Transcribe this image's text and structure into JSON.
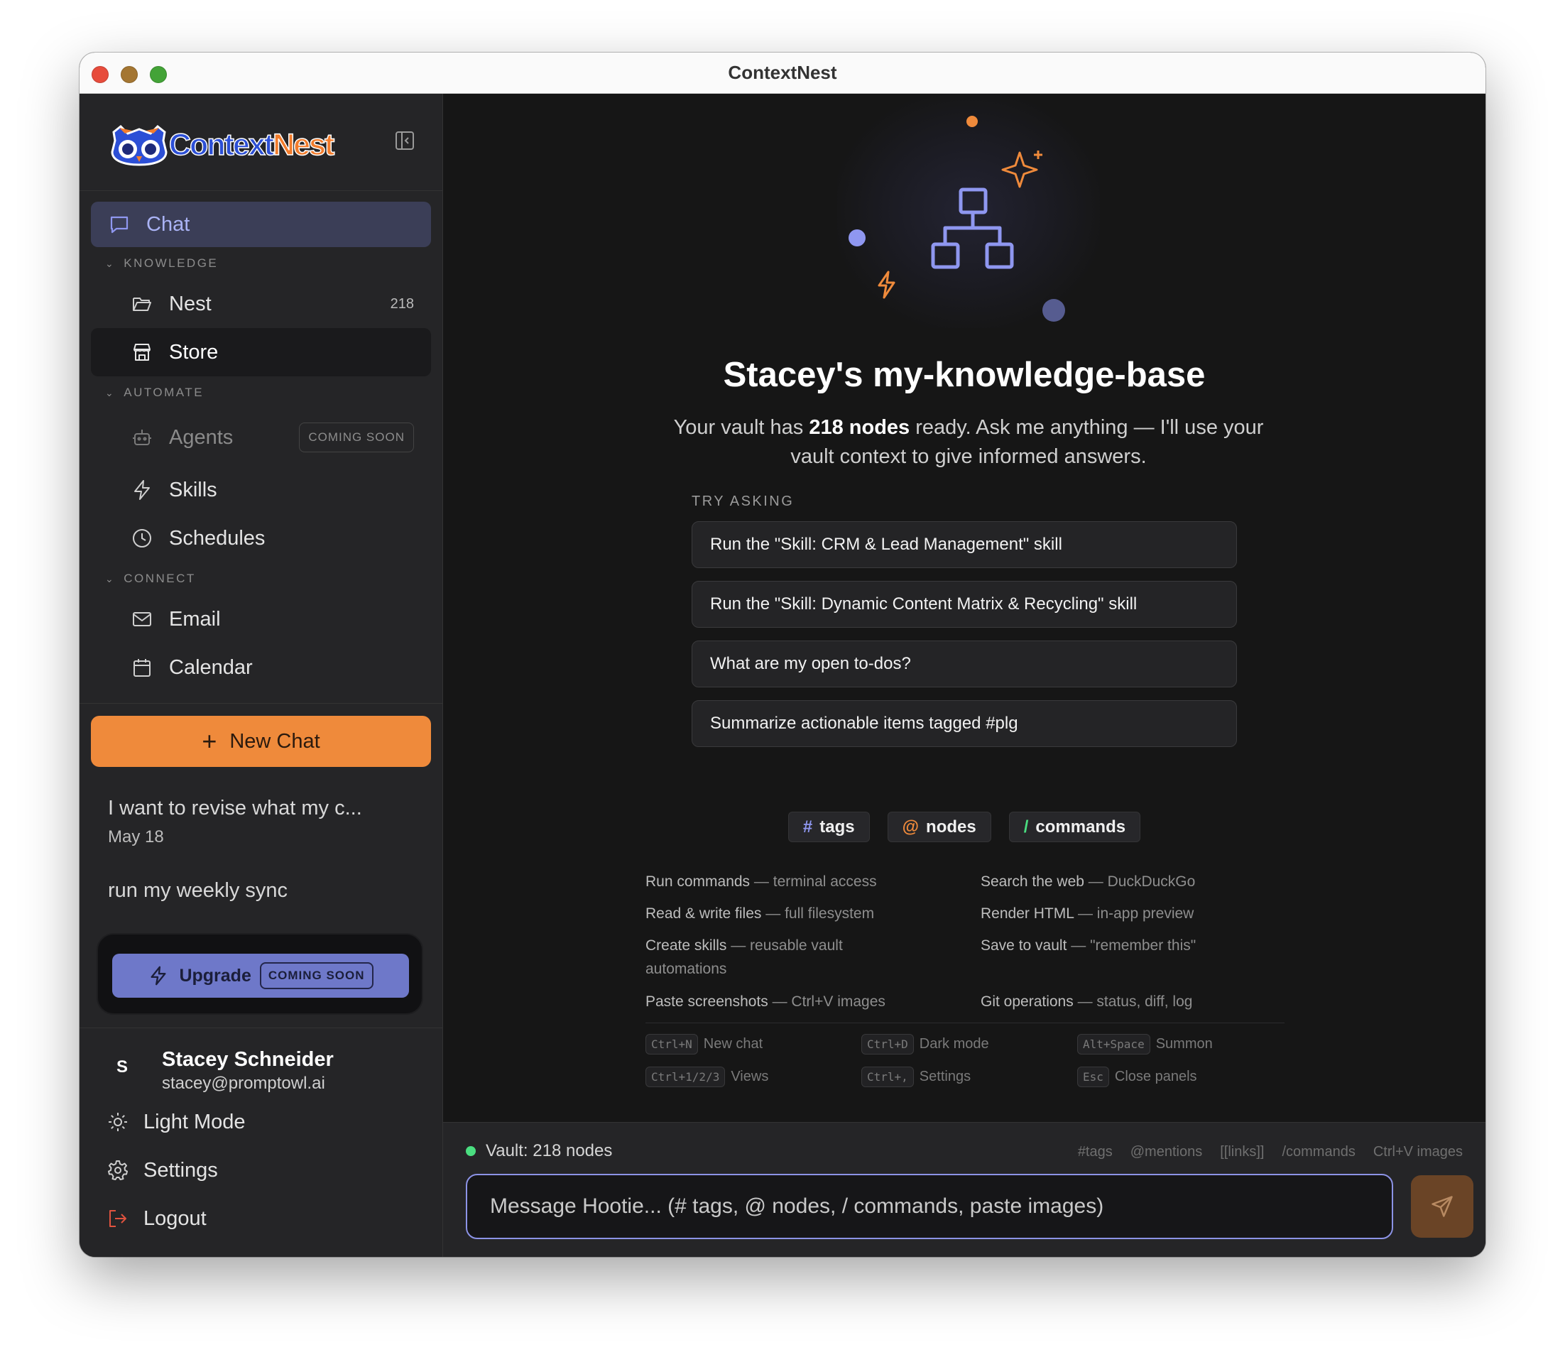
{
  "window": {
    "title": "ContextNest"
  },
  "sidebar": {
    "logo": {
      "part1": "Context",
      "part2": "Nest"
    },
    "chat_label": "Chat",
    "sections": {
      "knowledge": "KNOWLEDGE",
      "automate": "AUTOMATE",
      "connect": "CONNECT"
    },
    "nest": {
      "label": "Nest",
      "count": "218"
    },
    "store": {
      "label": "Store"
    },
    "agents": {
      "label": "Agents",
      "badge": "COMING SOON"
    },
    "skills": {
      "label": "Skills"
    },
    "schedules": {
      "label": "Schedules"
    },
    "email": {
      "label": "Email"
    },
    "calendar": {
      "label": "Calendar"
    },
    "new_chat": {
      "icon": "+",
      "label": "New Chat"
    },
    "history": [
      {
        "title": "I want to revise what my c...",
        "date": "May 18"
      },
      {
        "title": "run my weekly sync"
      }
    ],
    "upgrade": {
      "label": "Upgrade",
      "badge": "COMING SOON"
    },
    "user": {
      "initial": "S",
      "name": "Stacey Schneider",
      "email": "stacey@promptowl.ai"
    },
    "light_mode": "Light Mode",
    "settings": "Settings",
    "logout": "Logout"
  },
  "main": {
    "heading": "Stacey's my-knowledge-base",
    "subtitle": {
      "pre": "Your vault has ",
      "bold": "218 nodes",
      "post": " ready. Ask me anything — I'll use your vault context to give informed answers."
    },
    "try_label": "TRY ASKING",
    "suggestions": [
      "Run the \"Skill: CRM & Lead Management\" skill",
      "Run the \"Skill: Dynamic Content Matrix & Recycling\" skill",
      "What are my open to-dos?",
      "Summarize actionable items tagged #plg"
    ],
    "chips": [
      {
        "symbol": "#",
        "label": "tags",
        "color": "#8f97f0"
      },
      {
        "symbol": "@",
        "label": "nodes",
        "color": "#ef8a3b"
      },
      {
        "symbol": "/",
        "label": "commands",
        "color": "#4ade80"
      }
    ],
    "capabilities": [
      {
        "title": "Run commands",
        "desc": " — terminal access"
      },
      {
        "title": "Search the web",
        "desc": " — DuckDuckGo"
      },
      {
        "title": "Read & write files",
        "desc": " — full filesystem"
      },
      {
        "title": "Render HTML",
        "desc": " — in-app preview"
      },
      {
        "title": "Create skills",
        "desc": " — reusable vault automations"
      },
      {
        "title": "Save to vault",
        "desc": " — \"remember this\""
      },
      {
        "title": "Paste screenshots",
        "desc": " — Ctrl+V images"
      },
      {
        "title": "Git operations",
        "desc": " — status, diff, log"
      }
    ],
    "shortcuts": [
      {
        "key": "Ctrl+N",
        "label": "New chat"
      },
      {
        "key": "Ctrl+D",
        "label": "Dark mode"
      },
      {
        "key": "Alt+Space",
        "label": "Summon"
      },
      {
        "key": "Ctrl+1/2/3",
        "label": "Views"
      },
      {
        "key": "Ctrl+,",
        "label": "Settings"
      },
      {
        "key": "Esc",
        "label": "Close panels"
      }
    ]
  },
  "footer": {
    "vault_status": "Vault: 218 nodes",
    "hints": [
      "#tags",
      "@mentions",
      "[[links]]",
      "/commands",
      "Ctrl+V images"
    ],
    "input_placeholder": "Message Hootie... (# tags, @ nodes, / commands, paste images)"
  },
  "colors": {
    "accent_orange": "#ef8a3b",
    "accent_indigo": "#8f97f0",
    "status_green": "#4ade80"
  }
}
